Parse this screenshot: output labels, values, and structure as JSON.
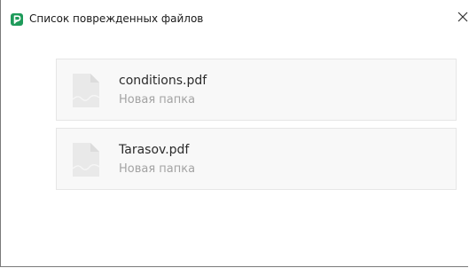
{
  "window": {
    "title": "Список поврежденных файлов",
    "close_glyph": "×",
    "app_icon": "p-app-icon",
    "accent_color": "#1e9b5a"
  },
  "files": [
    {
      "name": "conditions.pdf",
      "folder": "Новая папка",
      "icon": "document-file-icon"
    },
    {
      "name": "Tarasov.pdf",
      "folder": "Новая папка",
      "icon": "document-file-icon"
    }
  ]
}
